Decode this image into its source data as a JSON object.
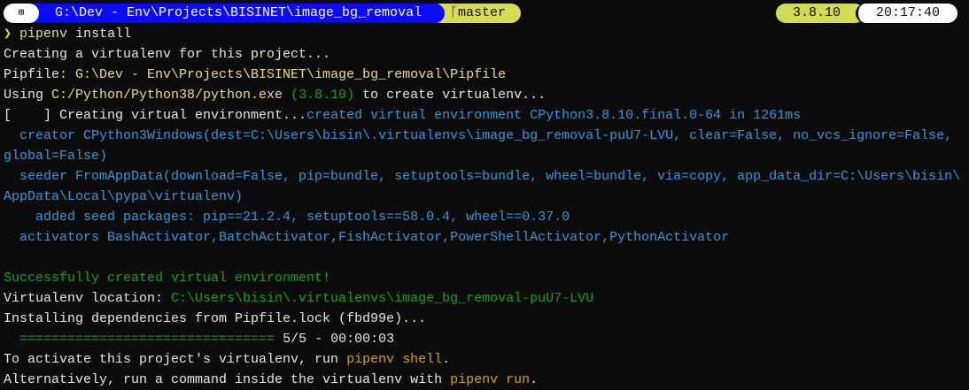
{
  "prompt_bar": {
    "os_icon": "windows-icon",
    "os_glyph": "⊞",
    "path": "G:\\Dev - Env\\Projects\\BISINET\\image_bg_removal",
    "branch_glyph": "ᚴ",
    "branch": "master",
    "python_version": "3.8.10",
    "clock": "20:17:40"
  },
  "colors": {
    "path_bg": "#0b0bf5",
    "accent": "#d4dc56",
    "green": "#16a216",
    "blue": "#3a96dd",
    "yellow": "#e8dc8c",
    "orange": "#d6a400"
  },
  "lines": [
    [
      [
        "p",
        "❯ "
      ],
      [
        "y",
        "pipenv"
      ],
      [
        "w",
        " install"
      ]
    ],
    [
      [
        "w",
        "Creating a virtualenv for this project..."
      ]
    ],
    [
      [
        "w",
        "Pipfile: "
      ],
      [
        "y",
        "G:\\Dev - Env\\Projects\\BISINET\\image_bg_removal\\Pipfile"
      ]
    ],
    [
      [
        "w",
        "Using "
      ],
      [
        "y",
        "C:/Python/Python38/python.exe"
      ],
      [
        "w",
        " "
      ],
      [
        "g",
        "(3.8.10)"
      ],
      [
        "w",
        " to create virtualenv..."
      ]
    ],
    [
      [
        "w",
        "[    ] Creating virtual environment..."
      ],
      [
        "b",
        "created virtual environment CPython3.8.10.final.0-64 in 1261ms"
      ]
    ],
    [
      [
        "b",
        "  creator CPython3Windows(dest=C:\\Users\\bisin\\.virtualenvs\\image_bg_removal-puU7-LVU, clear=False, no_vcs_ignore=False,"
      ]
    ],
    [
      [
        "b",
        "global=False)"
      ]
    ],
    [
      [
        "b",
        "  seeder FromAppData(download=False, pip=bundle, setuptools=bundle, wheel=bundle, via=copy, app_data_dir=C:\\Users\\bisin\\"
      ]
    ],
    [
      [
        "b",
        "AppData\\Local\\pypa\\virtualenv)"
      ]
    ],
    [
      [
        "b",
        "    added seed packages: pip==21.2.4, setuptools==58.0.4, wheel==0.37.0"
      ]
    ],
    [
      [
        "b",
        "  activators BashActivator,BatchActivator,FishActivator,PowerShellActivator,PythonActivator"
      ]
    ],
    [],
    [
      [
        "g",
        "Successfully created virtual environment!"
      ]
    ],
    [
      [
        "w",
        "Virtualenv location: "
      ],
      [
        "g",
        "C:\\Users\\bisin\\.virtualenvs\\image_bg_removal-puU7-LVU"
      ]
    ],
    [
      [
        "w",
        "Installing dependencies from Pipfile.lock (fbd99e)..."
      ]
    ],
    [
      [
        "g",
        "  ================================"
      ],
      [
        "w",
        " 5/5 - 00:00:03"
      ]
    ],
    [
      [
        "w",
        "To activate this project's virtualenv, run "
      ],
      [
        "o",
        "pipenv shell"
      ],
      [
        "w",
        "."
      ]
    ],
    [
      [
        "w",
        "Alternatively, run a command inside the virtualenv with "
      ],
      [
        "o",
        "pipenv run"
      ],
      [
        "w",
        "."
      ]
    ]
  ]
}
